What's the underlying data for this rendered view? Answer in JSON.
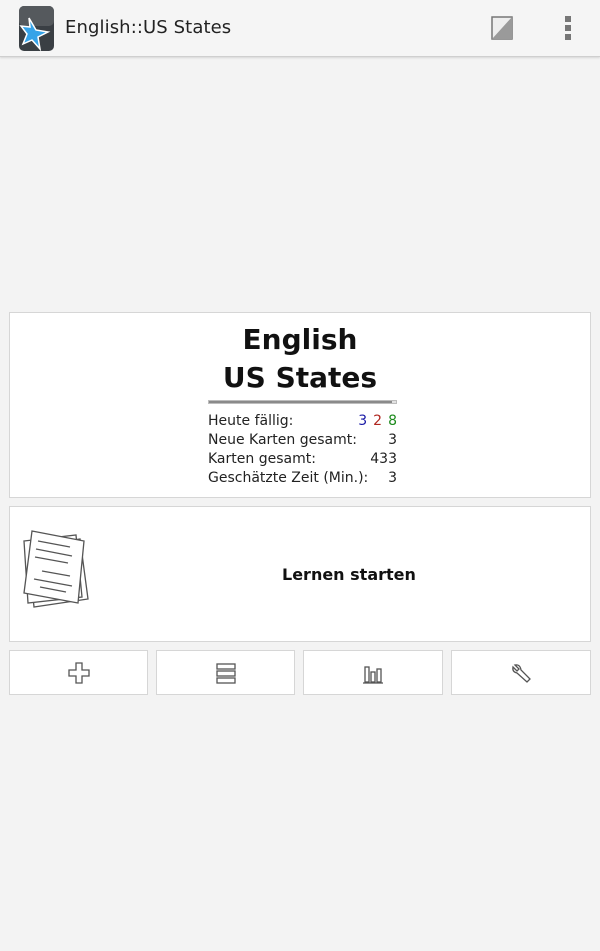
{
  "app": {
    "title": "English::US States",
    "icons": {
      "app": "anki-star-icon",
      "edit": "edit-note-icon",
      "overflow": "overflow-menu-icon"
    }
  },
  "deck": {
    "title_line1": "English",
    "title_line2": "US States",
    "progress_fraction": 0.98,
    "stats": {
      "due_label": "Heute fällig:",
      "due_new": "3",
      "due_learning": "2",
      "due_review": "8",
      "new_total_label": "Neue Karten gesamt:",
      "new_total_value": "3",
      "cards_total_label": "Karten gesamt:",
      "cards_total_value": "433",
      "est_time_label": "Geschätzte Zeit (Min.):",
      "est_time_value": "3"
    }
  },
  "study": {
    "label": "Lernen starten",
    "icon": "cards-stack-icon"
  },
  "bottom_buttons": [
    {
      "name": "add",
      "icon": "add-icon"
    },
    {
      "name": "browse",
      "icon": "list-icon"
    },
    {
      "name": "statistics",
      "icon": "bar-chart-icon"
    },
    {
      "name": "options",
      "icon": "wrench-icon"
    }
  ],
  "colors": {
    "new": "#1a1aa6",
    "learning": "#b0261f",
    "review": "#1c8a1c"
  }
}
